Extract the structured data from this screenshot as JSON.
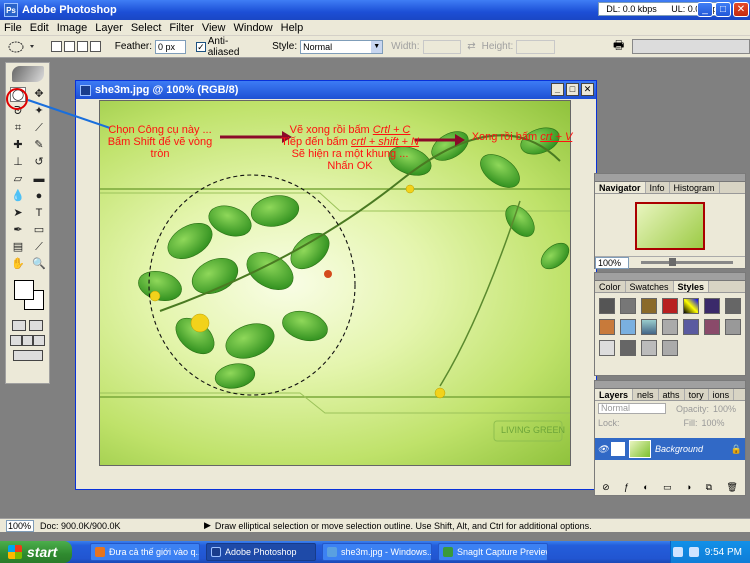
{
  "window": {
    "title": "Adobe Photoshop",
    "app_icon": "Ps",
    "net_dl": "DL: 0.0 kbps",
    "net_ul": "UL: 0.0 kbps",
    "minimize": "_",
    "maximize": "□",
    "close": "✕"
  },
  "menu": [
    "File",
    "Edit",
    "Image",
    "Layer",
    "Select",
    "Filter",
    "View",
    "Window",
    "Help"
  ],
  "options": {
    "feather_label": "Feather:",
    "feather_value": "0 px",
    "antialiased_label": "Anti-aliased",
    "style_label": "Style:",
    "style_value": "Normal",
    "width_label": "Width:",
    "height_label": "Height:"
  },
  "document": {
    "title": "she3m.jpg @ 100% (RGB/8)",
    "btn_min": "_",
    "btn_max": "□",
    "btn_close": "✕",
    "watermark": "LIVING GREEN"
  },
  "annotations": {
    "step1_line1": "Chọn Công cụ này ...",
    "step1_line2": "Bấm Shift để vẽ vòng",
    "step1_line3": "tròn",
    "step2_line1_pre": "Vẽ xong rồi bấm ",
    "step2_line1_key": "Crtl + C",
    "step2_line2_pre": "Tiếp đến bấm ",
    "step2_line2_key": "crtl + shift + N",
    "step2_line3": "Sẽ hiện ra một khung ...",
    "step2_line4": "Nhấn OK",
    "step3_pre": "Xong rồi bấm ",
    "step3_key": "crt + V",
    "accent_color": "#ff1111",
    "arrow_color": "#8b0a2a",
    "pointer_color": "#1a6fdc"
  },
  "navigator_panel": {
    "tabs": [
      "Navigator",
      "Info",
      "Histogram"
    ],
    "active": "Navigator",
    "zoom": "100%"
  },
  "styles_panel": {
    "tabs": [
      "Color",
      "Swatches",
      "Styles"
    ],
    "active": "Styles"
  },
  "layers_panel": {
    "tabs": [
      "Layers",
      "nels",
      "aths",
      "tory",
      "ions"
    ],
    "active": "Layers",
    "blend_mode": "Normal",
    "opacity_label": "Opacity:",
    "opacity_value": "100%",
    "lock_label": "Lock:",
    "fill_label": "Fill:",
    "fill_value": "100%",
    "layer_name": "Background",
    "eye_icon": "👁",
    "lock_icon": "🔒"
  },
  "statusbar": {
    "zoom": "100%",
    "doc": "Doc: 900.0K/900.0K",
    "hint": "Draw elliptical selection or move selection outline.  Use Shift, Alt, and Ctrl for additional options."
  },
  "taskbar": {
    "start": "start",
    "tasks": [
      "Đưa cả thế giới vào q...",
      "Adobe Photoshop",
      "she3m.jpg - Windows...",
      "SnagIt Capture Preview"
    ],
    "clock": "9:54 PM"
  }
}
